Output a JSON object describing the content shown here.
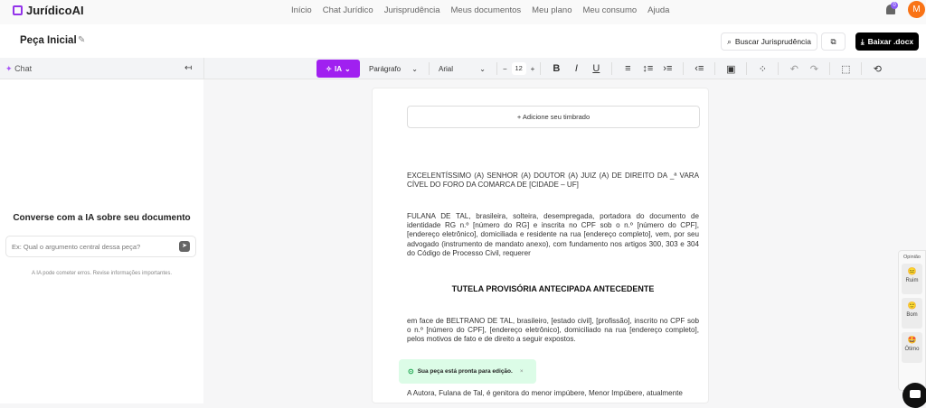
{
  "app": {
    "name": "JurídicoAI"
  },
  "nav": [
    "Início",
    "Chat Jurídico",
    "Jurisprudência",
    "Meus documentos",
    "Meu plano",
    "Meu consumo",
    "Ajuda"
  ],
  "notifications": {
    "count": "0"
  },
  "user": {
    "initial": "M",
    "color": "#f97316"
  },
  "header": {
    "title": "Peça Inicial",
    "search_label": "Buscar Jurisprudência",
    "download_label": "Baixar .docx"
  },
  "toolbar": {
    "chat_label": "Chat",
    "ia_label": "IA",
    "paragraph": "Parágrafo",
    "font": "Arial",
    "font_size": "12",
    "accent": "#a020f0"
  },
  "chat": {
    "heading": "Converse com a IA sobre seu documento",
    "placeholder": "Ex: Qual o argumento central dessa peça?",
    "note": "A IA pode cometer erros. Revise informações importantes."
  },
  "document": {
    "add_letterhead": "Adicione seu timbrado",
    "p1": "EXCELENTÍSSIMO (A) SENHOR (A) DOUTOR (A) JUIZ (A) DE DIREITO DA _ª VARA CÍVEL DO FORO DA COMARCA DE [CIDADE – UF]",
    "p2": "FULANA DE TAL, brasileira, solteira, desempregada, portadora do documento de identidade RG n.º [número do RG] e inscrita no CPF sob o n.º [número do CPF], [endereço eletrônico], domiciliada e residente na rua [endereço completo], vem, por seu advogado (instrumento de mandato anexo), com fundamento nos artigos 300, 303 e 304 do Código de Processo Civil, requerer",
    "heading": "TUTELA PROVISÓRIA ANTECIPADA ANTECEDENTE",
    "p3": "em face de BELTRANO DE TAL, brasileiro, [estado civil], [profissão], inscrito no CPF sob o n.º [número do CPF], [endereço eletrônico], domiciliado na rua [endereço completo], pelos motivos de fato e de direito a seguir expostos.",
    "p4": "A Autora, Fulana de Tal, é genitora do menor impúbere, Menor Impúbere, atualmente"
  },
  "toast": {
    "message": "Sua peça está pronta para edição."
  },
  "feedback": {
    "title": "Opinião",
    "options": [
      "Ruim",
      "Bom",
      "Ótimo"
    ]
  }
}
